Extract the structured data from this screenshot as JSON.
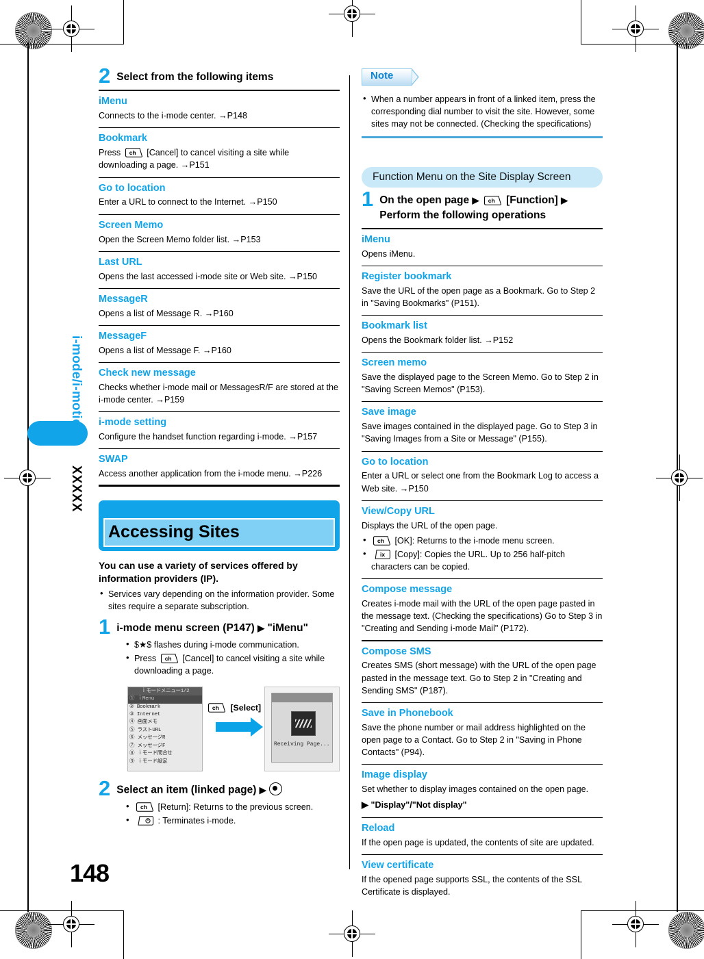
{
  "page": {
    "number": "148",
    "side_index_title": "i-mode/i-motion",
    "side_index_code": "XXXXX"
  },
  "left_column": {
    "step2": {
      "num": "2",
      "text": "Select from the following items"
    },
    "menu_items": [
      {
        "title": "iMenu",
        "desc": "Connects to the i-mode center. →P148"
      },
      {
        "title": "Bookmark",
        "desc_pre": "Press",
        "key": "ch",
        "desc_post": "[Cancel] to cancel visiting a site while downloading a page. →P151"
      },
      {
        "title": "Go to location",
        "desc": "Enter a URL to connect to the Internet. →P150"
      },
      {
        "title": "Screen Memo",
        "desc": "Open the Screen Memo folder list. →P153"
      },
      {
        "title": "Last URL",
        "desc": "Opens the last accessed i-mode site or Web site. →P150"
      },
      {
        "title": "MessageR",
        "desc": "Opens a list of Message R. →P160"
      },
      {
        "title": "MessageF",
        "desc": "Opens a list of Message F. →P160"
      },
      {
        "title": "Check new message",
        "desc": "Checks whether i-mode mail or MessagesR/F are stored at the i-mode center. →P159"
      },
      {
        "title": "i-mode setting",
        "desc": "Configure the handset function regarding i-mode. →P157"
      },
      {
        "title": "SWAP",
        "desc": "Access another application from the i-mode menu. →P226"
      }
    ],
    "section_banner": {
      "title": "Accessing Sites"
    },
    "lead": "You can use a variety of services offered by information providers (IP).",
    "lead_bullets": [
      "Services vary depending on the information provider. Some sites require a separate subscription."
    ],
    "step1": {
      "num": "1",
      "text_pre": "i-mode menu screen (P147)",
      "text_post": "\"iMenu\""
    },
    "step1_bullets": [
      {
        "text": "$★$ flashes during i-mode communication."
      },
      {
        "pre": "Press",
        "key": "ch",
        "post": "[Cancel] to cancel visiting a site while downloading a page."
      }
    ],
    "figure": {
      "left_shot": {
        "title": "ｉモードメニュー1/2",
        "rows": [
          "① ｉMenu",
          "② Bookmark",
          "③ Internet",
          "④ 画面メモ",
          "⑤ ラストURL",
          "⑥ メッセージR",
          "⑦ メッセージF",
          "⑧ ｉモード問合せ",
          "⑨ ｉモード設定"
        ],
        "selected_index": 0
      },
      "middle": {
        "key": "ch",
        "label": "[Select]"
      },
      "right_shot": {
        "caption": "Receiving Page..."
      }
    },
    "step2b": {
      "num": "2",
      "text": "Select an item (linked page)"
    },
    "step2b_bullets": [
      {
        "key": "ch",
        "post": "[Return]: Returns to the previous screen."
      },
      {
        "key": "clr",
        "post": ": Terminates i-mode."
      }
    ]
  },
  "right_column": {
    "note": {
      "label": "Note",
      "bullets": [
        "When a number appears in front of a linked item, press the corresponding dial number to visit the site. However, some sites may not be connected. (Checking the specifications)"
      ]
    },
    "function_banner": "Function Menu on the Site Display Screen",
    "step1": {
      "num": "1",
      "text_pre": "On the open page",
      "key": "ch",
      "text_mid": "[Function]",
      "text_post": "Perform the following operations"
    },
    "menu_items": [
      {
        "title": "iMenu",
        "desc": "Opens iMenu."
      },
      {
        "title": "Register bookmark",
        "desc": "Save the URL of the open page as a Bookmark. Go to Step 2 in \"Saving Bookmarks\" (P151)."
      },
      {
        "title": "Bookmark list",
        "desc": "Opens the Bookmark folder list. →P152"
      },
      {
        "title": "Screen memo",
        "desc": "Save the displayed page to the Screen Memo. Go to Step 2 in \"Saving Screen Memos\" (P153)."
      },
      {
        "title": "Save image",
        "desc": "Save images contained in the displayed page. Go to Step 3 in \"Saving Images from a Site or Message\" (P155)."
      },
      {
        "title": "Go to location",
        "desc": "Enter a URL or select one from the Bookmark Log to access a Web site. →P150"
      },
      {
        "title": "View/Copy URL",
        "desc": "Displays the URL of the open page.",
        "bullets": [
          {
            "key": "ch",
            "post": "[OK]: Returns to the i-mode menu screen."
          },
          {
            "key": "ix",
            "post": "[Copy]: Copies the URL. Up to 256 half-pitch characters can be copied."
          }
        ]
      },
      {
        "title": "Compose message",
        "desc": "Creates i-mode mail with the URL of the open page pasted in the message text. (Checking the specifications) Go to Step 3 in \"Creating and Sending i-mode Mail\" (P172)."
      },
      {
        "title": "Compose SMS",
        "desc": "Creates SMS (short message) with the URL of the open page pasted in the message text. Go to Step 2 in \"Creating and Sending SMS\" (P187)."
      },
      {
        "title": "Save in Phonebook",
        "desc": "Save the phone number or mail address highlighted on the open page to a Contact. Go to Step 2 in \"Saving in Phone Contacts\" (P94)."
      },
      {
        "title": "Image display",
        "desc": "Set whether to display images contained on the open page.",
        "option": "\"Display\"/\"Not display\""
      },
      {
        "title": "Reload",
        "desc": "If the open page is updated, the contents of site are updated."
      },
      {
        "title": "View certificate",
        "desc": "If the opened page supports SSL, the contents of the SSL Certificate is displayed."
      }
    ]
  },
  "colors": {
    "accent_blue": "#11a4e8",
    "banner_light": "#7fd0f4",
    "note_fill": "#c9e9f8"
  }
}
